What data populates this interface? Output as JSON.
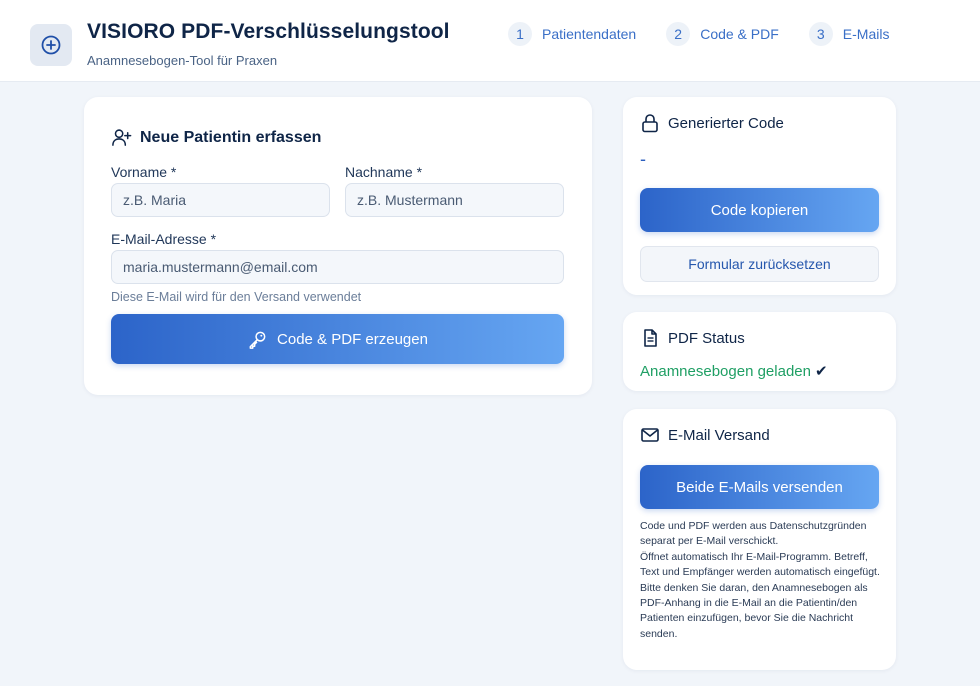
{
  "header": {
    "logo_icon": "plus-circle-icon",
    "title": "VISIORO PDF-Verschlüsselungstool",
    "subtitle": "Anamnesebogen-Tool für Praxen",
    "steps": [
      {
        "number": "1",
        "label": "Patientendaten"
      },
      {
        "number": "2",
        "label": "Code & PDF"
      },
      {
        "number": "3",
        "label": "E-Mails"
      }
    ]
  },
  "form": {
    "icon": "user-plus-icon",
    "title": "Neue Patientin erfassen",
    "firstname_label": "Vorname *",
    "firstname_placeholder": "z.B. Maria",
    "firstname_value": "",
    "lastname_label": "Nachname *",
    "lastname_placeholder": "z.B. Mustermann",
    "lastname_value": "",
    "email_label": "E-Mail-Adresse *",
    "email_placeholder": "maria.mustermann@email.com",
    "email_value": "",
    "email_hint": "Diese E-Mail wird für den Versand verwendet",
    "submit_icon": "key-icon",
    "submit_label": "Code & PDF erzeugen"
  },
  "code_panel": {
    "icon": "lock-icon",
    "title": "Generierter Code",
    "value": "-",
    "copy_label": "Code kopieren",
    "reset_label": "Formular zurücksetzen"
  },
  "pdf_panel": {
    "icon": "document-icon",
    "title": "PDF Status",
    "status": "Anamnesebogen geladen",
    "status_mark": "✔"
  },
  "email_panel": {
    "icon": "mail-icon",
    "title": "E-Mail Versand",
    "send_label": "Beide E-Mails versenden",
    "info": [
      "Code und PDF werden aus Datenschutzgründen separat per E-Mail verschickt.",
      "Öffnet automatisch Ihr E-Mail-Programm. Betreff, Text und Empfänger werden automatisch eingefügt.",
      "Bitte denken Sie daran, den Anamnesebogen als PDF-Anhang in die E-Mail an die Patientin/den Patienten einzufügen, bevor Sie die Nachricht senden."
    ]
  },
  "colors": {
    "accent": "#2c64c9",
    "accent_light": "#66a6f2",
    "success": "#1f9f64",
    "background": "#f1f5fa",
    "text_dark": "#0f2547"
  }
}
